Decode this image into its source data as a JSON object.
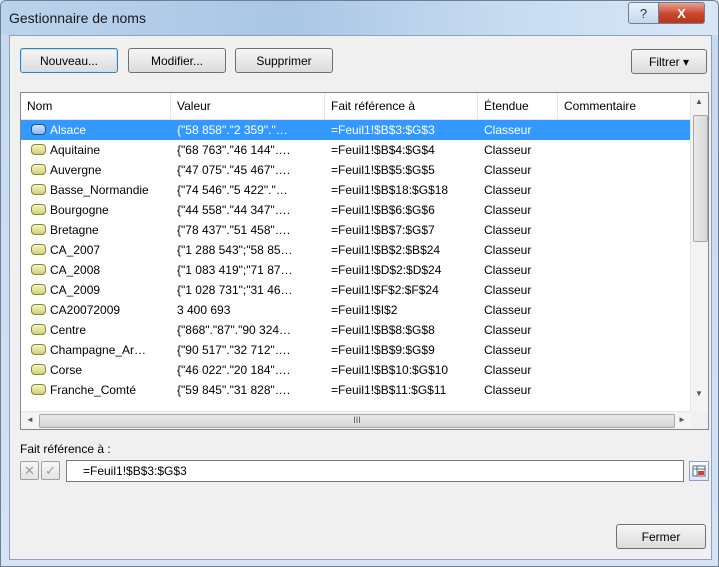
{
  "window": {
    "title": "Gestionnaire de noms",
    "help_glyph": "?",
    "close_glyph": "X"
  },
  "toolbar": {
    "new_label": "Nouveau...",
    "edit_label": "Modifier...",
    "delete_label": "Supprimer",
    "filter_label": "Filtrer ▾"
  },
  "columns": [
    "Nom",
    "Valeur",
    "Fait référence à",
    "Étendue",
    "Commentaire"
  ],
  "rows": [
    {
      "name": "Alsace",
      "value": "{\"58 858\".\"2 359\".\"…",
      "ref": "=Feuil1!$B$3:$G$3",
      "scope": "Classeur",
      "comment": "",
      "selected": true
    },
    {
      "name": "Aquitaine",
      "value": "{\"68 763\".\"46 144\"….",
      "ref": "=Feuil1!$B$4:$G$4",
      "scope": "Classeur",
      "comment": ""
    },
    {
      "name": "Auvergne",
      "value": "{\"47 075\".\"45 467\"….",
      "ref": "=Feuil1!$B$5:$G$5",
      "scope": "Classeur",
      "comment": ""
    },
    {
      "name": "Basse_Normandie",
      "value": "{\"74 546\".\"5 422\".\"…",
      "ref": "=Feuil1!$B$18:$G$18",
      "scope": "Classeur",
      "comment": ""
    },
    {
      "name": "Bourgogne",
      "value": "{\"44 558\".\"44 347\"….",
      "ref": "=Feuil1!$B$6:$G$6",
      "scope": "Classeur",
      "comment": ""
    },
    {
      "name": "Bretagne",
      "value": "{\"78 437\".\"51 458\"….",
      "ref": "=Feuil1!$B$7:$G$7",
      "scope": "Classeur",
      "comment": ""
    },
    {
      "name": "CA_2007",
      "value": "{\"1 288 543\";\"58 85…",
      "ref": "=Feuil1!$B$2:$B$24",
      "scope": "Classeur",
      "comment": ""
    },
    {
      "name": "CA_2008",
      "value": "{\"1 083 419\";\"71 87…",
      "ref": "=Feuil1!$D$2:$D$24",
      "scope": "Classeur",
      "comment": ""
    },
    {
      "name": "CA_2009",
      "value": "{\"1 028 731\";\"31 46…",
      "ref": "=Feuil1!$F$2:$F$24",
      "scope": "Classeur",
      "comment": ""
    },
    {
      "name": "CA20072009",
      "value": "3 400 693",
      "ref": "=Feuil1!$I$2",
      "scope": "Classeur",
      "comment": ""
    },
    {
      "name": "Centre",
      "value": "{\"868\".\"87\".\"90 324…",
      "ref": "=Feuil1!$B$8:$G$8",
      "scope": "Classeur",
      "comment": ""
    },
    {
      "name": "Champagne_Ar…",
      "value": "{\"90 517\".\"32 712\"….",
      "ref": "=Feuil1!$B$9:$G$9",
      "scope": "Classeur",
      "comment": ""
    },
    {
      "name": "Corse",
      "value": "{\"46 022\".\"20 184\"….",
      "ref": "=Feuil1!$B$10:$G$10",
      "scope": "Classeur",
      "comment": ""
    },
    {
      "name": "Franche_Comté",
      "value": "{\"59 845\".\"31 828\"….",
      "ref": "=Feuil1!$B$11:$G$11",
      "scope": "Classeur",
      "comment": ""
    }
  ],
  "scroll": {
    "h_thumb_glyph": "III",
    "up": "▲",
    "down": "▼",
    "left": "◄",
    "right": "►"
  },
  "refers_to": {
    "label": "Fait référence à :",
    "value": "=Feuil1!$B$3:$G$3",
    "cancel_glyph": "✕",
    "confirm_glyph": "✓"
  },
  "footer": {
    "close_label": "Fermer"
  }
}
